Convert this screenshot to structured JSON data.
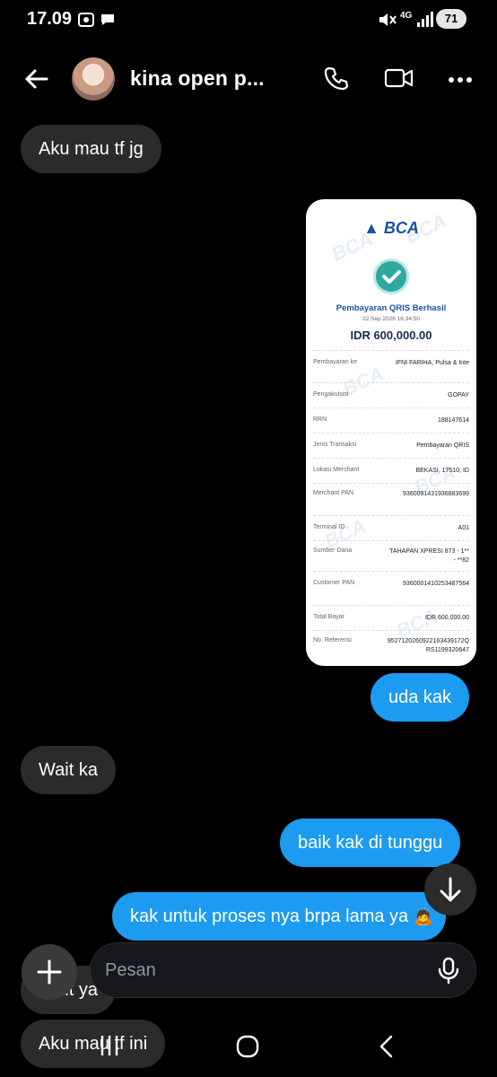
{
  "status_bar": {
    "time": "17.09",
    "network": "4G",
    "battery": "71",
    "icons": [
      "screenshot-icon",
      "chat-bubble-icon",
      "mute-icon",
      "signal-icon"
    ]
  },
  "header": {
    "title": "kina open p...",
    "icons": [
      "back-arrow-icon",
      "phone-icon",
      "video-icon",
      "more-icon"
    ]
  },
  "messages": [
    {
      "side": "received",
      "text": "Aku mau tf jg"
    },
    {
      "side": "sent",
      "type": "image"
    },
    {
      "side": "sent",
      "text": "uda kak"
    },
    {
      "side": "received",
      "text": "Wait ka"
    },
    {
      "side": "sent",
      "text": "baik kak di tunggu"
    },
    {
      "side": "sent",
      "text": "kak untuk proses nya brpa lama ya",
      "emoji": "person-bowing-emoji"
    },
    {
      "side": "received",
      "text": "Wait ya"
    },
    {
      "side": "received",
      "text": "Aku mau tf ini"
    }
  ],
  "receipt": {
    "bank": "BCA",
    "title": "Pembayaran QRIS Berhasil",
    "date": "22 Sep 2026 16:34:50",
    "amount": "IDR 600,000.00",
    "rows": [
      {
        "label": "Pembayaran ke",
        "value": "IFNI FARIHA, Pulsa & Inte"
      },
      {
        "label": "Pengakuisisi",
        "value": "GOPAY"
      },
      {
        "label": "RRN",
        "value": "188147614"
      },
      {
        "label": "Jenis Transaksi",
        "value": "Pembayaran QRIS"
      },
      {
        "label": "Lokasi Merchant",
        "value": "BEKASI, 17510, ID"
      },
      {
        "label": "Merchant PAN",
        "value": "9360091431936883699"
      },
      {
        "label": "Terminal ID",
        "value": "A01"
      },
      {
        "label": "Sumber Dana",
        "value": "TAHAPAN XPRESI 873 - 1** - **82"
      },
      {
        "label": "Customer PAN",
        "value": "9360001410253487564"
      },
      {
        "label": "Total Bayar",
        "value": "IDR 600,000.00"
      },
      {
        "label": "No. Referensi",
        "value": "9527120260922163439172QRS1199320647"
      }
    ]
  },
  "composer": {
    "placeholder": "Pesan"
  },
  "colors": {
    "background": "#000000",
    "sent_bubble": "#1d9bf0",
    "received_bubble": "#2b2b2b",
    "bank_blue": "#1654a3"
  }
}
